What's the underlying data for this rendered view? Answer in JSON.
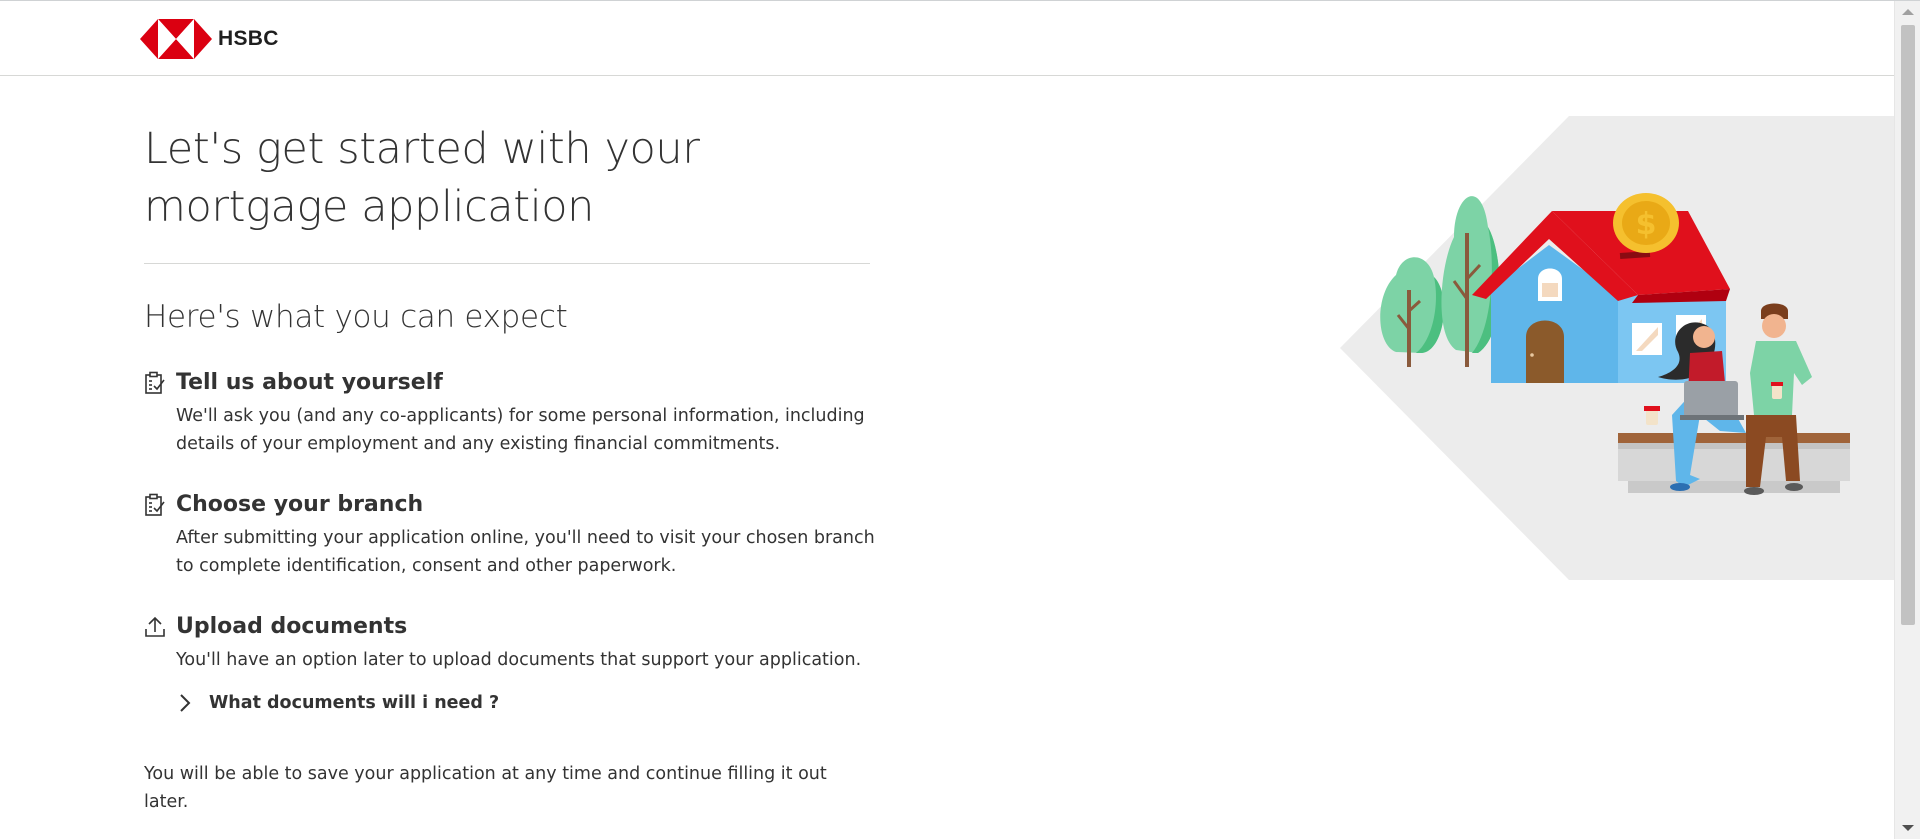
{
  "header": {
    "logo_text": "HSBC",
    "logo_icon": "hsbc-hexagon-logo",
    "brand_color": "#db0011"
  },
  "main": {
    "title": "Let's get started with your mortgage application",
    "section_title": "Here's what you can expect",
    "steps": [
      {
        "icon": "clipboard-check-icon",
        "title": "Tell us about yourself",
        "description": "We'll ask you (and any co-applicants) for some personal information, including details of your employment and any existing financial commitments."
      },
      {
        "icon": "clipboard-check-icon",
        "title": "Choose your branch",
        "description": "After submitting your application online, you'll need to visit your chosen branch to complete identification, consent and other paperwork."
      },
      {
        "icon": "upload-icon",
        "title": "Upload documents",
        "description": "You'll have an option later to upload documents that support your application."
      }
    ],
    "expander": {
      "icon": "chevron-right-icon",
      "label": "What documents will i need ?"
    },
    "save_note": "You will be able to save your application at any time and continue filling it out later."
  },
  "illustration": {
    "subject": "house-with-couple-illustration",
    "coin_symbol": "$"
  },
  "colors": {
    "text": "#333333",
    "rule": "#d7d8d6",
    "roof": "#e0101c",
    "house": "#5fb6ea",
    "tree": "#7dd3a6",
    "coin": "#f5c02e",
    "backdrop": "#ececec"
  }
}
